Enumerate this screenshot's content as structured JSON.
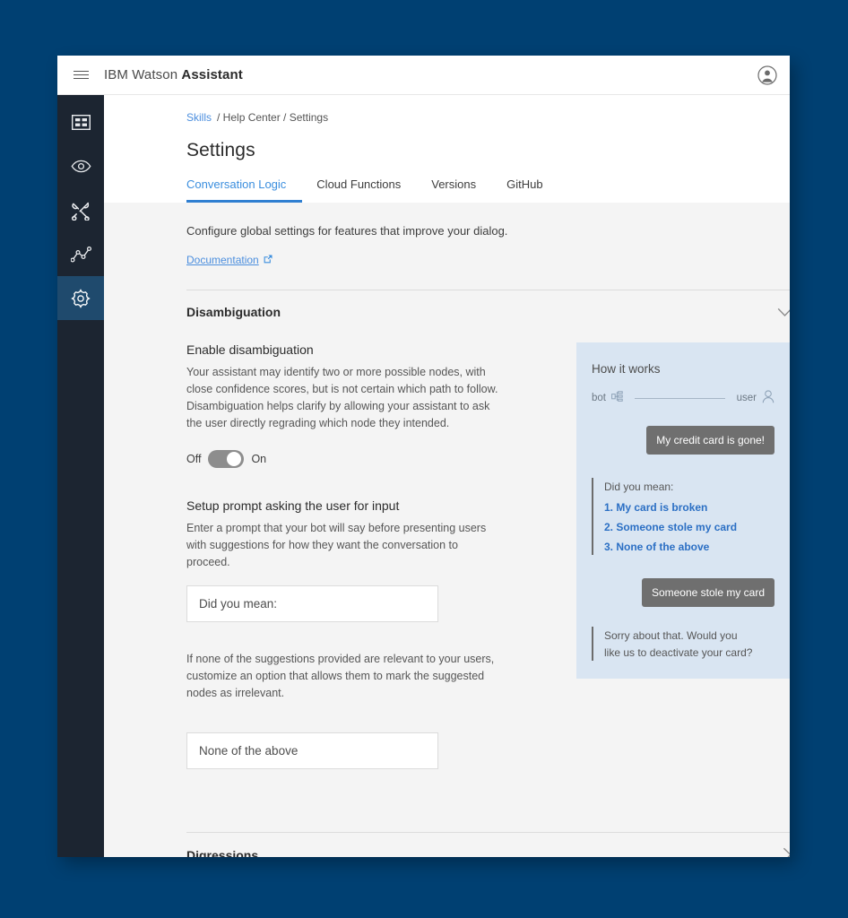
{
  "window": {
    "background_color": "#004072",
    "surface_color": "#f4f4f4"
  },
  "header": {
    "menu_icon": "hamburger-icon",
    "title_light": "IBM Watson ",
    "title_bold": "Assistant",
    "avatar_icon": "user-avatar-icon"
  },
  "sidebar": {
    "items": [
      {
        "icon": "dashboard-grid-icon",
        "active": false
      },
      {
        "icon": "eye-icon",
        "active": false
      },
      {
        "icon": "tools-icon",
        "active": false
      },
      {
        "icon": "analytics-line-chart-icon",
        "active": false
      },
      {
        "icon": "gear-icon",
        "active": true
      }
    ],
    "active_background": "#1f4a6d",
    "background": "#1c2531"
  },
  "breadcrumb": {
    "link": "Skills",
    "rest": "/ Help Center / Settings"
  },
  "page": {
    "title": "Settings"
  },
  "tabs": [
    {
      "label": "Conversation Logic",
      "active": true
    },
    {
      "label": "Cloud Functions",
      "active": false
    },
    {
      "label": "Versions",
      "active": false
    },
    {
      "label": "GitHub",
      "active": false
    }
  ],
  "intro": {
    "text": "Configure global settings for features that improve your dialog.",
    "doc_link": "Documentation",
    "doc_link_icon": "external-link-icon"
  },
  "sections": [
    {
      "title": "Disambiguation",
      "expanded": true,
      "chevron": "chevron-down-icon"
    },
    {
      "title": "Digressions",
      "expanded": false,
      "chevron": "chevron-right-icon"
    }
  ],
  "disambiguation": {
    "enable_label": "Enable disambiguation",
    "enable_description": "Your assistant may identify two or more possible nodes, with close confidence scores, but is not certain which path to follow. Disambiguation helps clarify by allowing your assistant to ask the user directly regrading which node they intended.",
    "toggle": {
      "off_label": "Off",
      "on_label": "On",
      "state": "on"
    },
    "prompt_label": "Setup prompt asking the user for input",
    "prompt_description": "Enter a prompt that your bot will say before presenting users with suggestions for how they want the conversation to proceed.",
    "prompt_value": "Did you mean:",
    "prompt_placeholder": "Did you mean:",
    "irrelevant_description": "If none of the suggestions provided are relevant to your users, customize an option that allows them to mark the suggested nodes as irrelevant.",
    "irrelevant_value": "None of the above",
    "irrelevant_placeholder": "None of the above"
  },
  "how_it_works": {
    "title": "How it works",
    "background_color": "#d9e5f2",
    "legend": {
      "bot_label": "bot",
      "bot_icon": "dialog-tree-icon",
      "user_label": "user",
      "user_icon": "person-icon"
    },
    "messages": [
      {
        "from": "user",
        "text": "My credit card is gone!"
      },
      {
        "from": "bot",
        "text": "Did you mean:",
        "suggestions": [
          "1. My card is broken",
          "2. Someone stole my card",
          "3. None of the above"
        ]
      },
      {
        "from": "user",
        "text": "Someone stole my card"
      },
      {
        "from": "bot",
        "lines": [
          "Sorry about that. Would you",
          "like us to deactivate your card?"
        ]
      }
    ],
    "colors": {
      "user_bubble": "#6f6f6f",
      "suggestion_link": "#2b6fc4"
    }
  }
}
